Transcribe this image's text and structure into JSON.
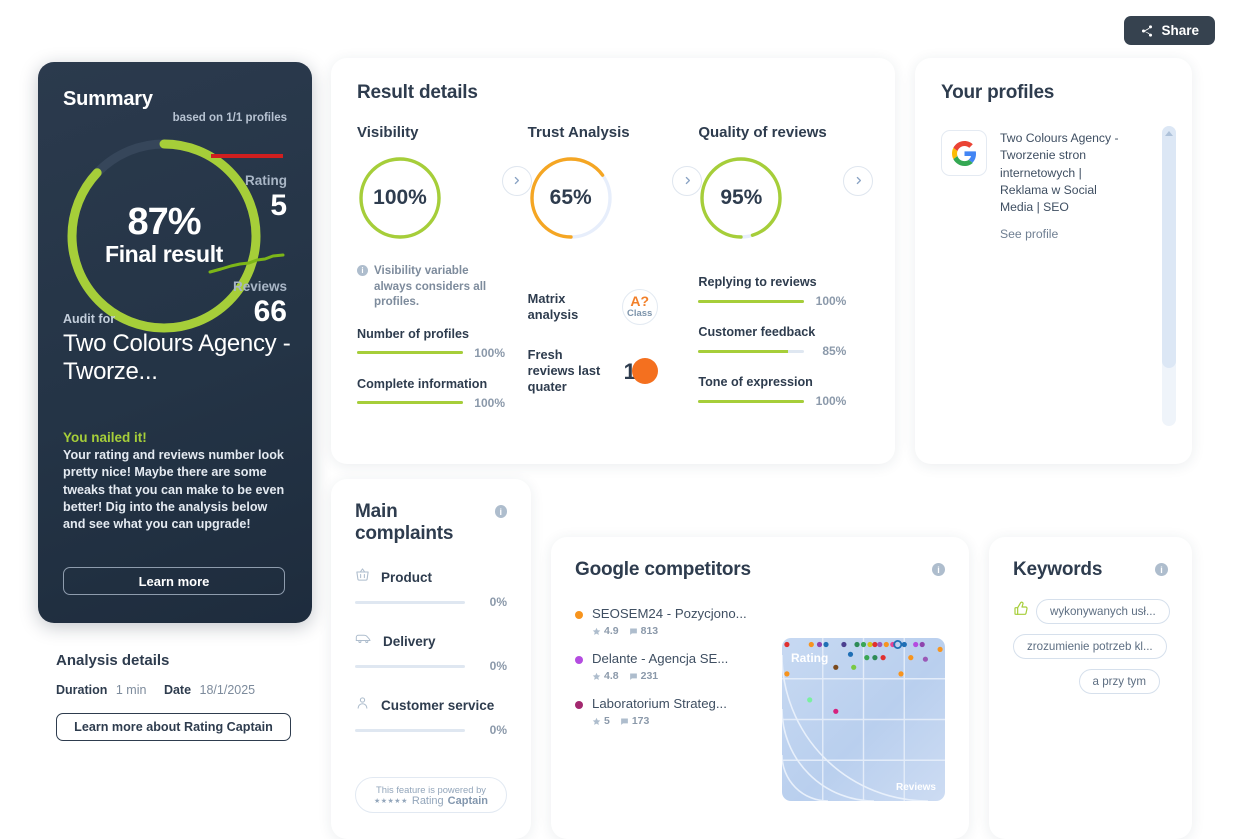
{
  "header": {
    "share_label": "Share"
  },
  "summary": {
    "title": "Summary",
    "based_on": "based on 1/1 profiles",
    "final_percent": "87%",
    "final_label": "Final result",
    "rating_label": "Rating",
    "rating_value": "5",
    "reviews_label": "Reviews",
    "reviews_value": "66",
    "audit_for_label": "Audit for",
    "audit_name": "Two Colours Agency - Tworze...",
    "nailed_title": "You nailed it!",
    "nailed_body": "Your rating and reviews number look pretty nice! Maybe there are some tweaks that you can make to be even better! Dig into the analysis below and see what you can upgrade!",
    "learn_more": "Learn more",
    "accent_green": "#a6ce39",
    "rating_trend_color": "#d01f1f",
    "reviews_trend_color": "#7cb518"
  },
  "analysis": {
    "title": "Analysis details",
    "duration_label": "Duration",
    "duration_value": "1 min",
    "date_label": "Date",
    "date_value": "18/1/2025",
    "button": "Learn more about Rating Captain"
  },
  "result": {
    "title": "Result details",
    "columns": [
      {
        "title": "Visibility",
        "percent": "100%",
        "ring_color": "#a6ce39",
        "note": "Visibility variable always considers all profiles.",
        "metrics": [
          {
            "label": "Number of profiles",
            "percent": "100%",
            "value": 100
          },
          {
            "label": "Complete information",
            "percent": "100%",
            "value": 100
          }
        ]
      },
      {
        "title": "Trust Analysis",
        "percent": "65%",
        "ring_color": "#f5a623",
        "matrix_label": "Matrix analysis",
        "matrix_class": "A?",
        "matrix_class_sub": "Class",
        "fresh_label": "Fresh reviews last quater",
        "fresh_value": "1"
      },
      {
        "title": "Quality of reviews",
        "percent": "95%",
        "ring_color": "#a6ce39",
        "metrics": [
          {
            "label": "Replying to reviews",
            "percent": "100%",
            "value": 100
          },
          {
            "label": "Customer feedback",
            "percent": "85%",
            "value": 85
          },
          {
            "label": "Tone of expression",
            "percent": "100%",
            "value": 100
          }
        ]
      }
    ]
  },
  "profiles": {
    "title": "Your profiles",
    "items": [
      {
        "name": "Two Colours Agency - Tworzenie stron internetowych | Reklama w Social Media | SEO",
        "link": "See profile"
      }
    ]
  },
  "complaints": {
    "title": "Main complaints",
    "items": [
      {
        "icon": "basket-icon",
        "label": "Product",
        "percent": "0%",
        "value": 0
      },
      {
        "icon": "van-icon",
        "label": "Delivery",
        "percent": "0%",
        "value": 0
      },
      {
        "icon": "person-icon",
        "label": "Customer service",
        "percent": "0%",
        "value": 0
      }
    ],
    "powered_line1": "This feature is powered by",
    "powered_stars": "★★★★★",
    "powered_brand_light": "Rating",
    "powered_brand_bold": "Captain"
  },
  "competitors": {
    "title": "Google competitors",
    "items": [
      {
        "name": "SEOSEM24 - Pozycjono...",
        "rating": "4.9",
        "reviews": "813",
        "color": "#f7941e"
      },
      {
        "name": "Delante - Agencja SE...",
        "rating": "4.8",
        "reviews": "231",
        "color": "#b44ce0"
      },
      {
        "name": "Laboratorium Strateg...",
        "rating": "5",
        "reviews": "173",
        "color": "#a3286f"
      }
    ]
  },
  "keywords": {
    "title": "Keywords",
    "chips": [
      "wykonywanych usł...",
      "zrozumienie potrzeb kl...",
      "a przy tym"
    ]
  },
  "chart_data": {
    "type": "scatter",
    "title": "",
    "xlabel": "Reviews",
    "ylabel": "Rating",
    "xlim": [
      0,
      100
    ],
    "ylim": [
      0,
      100
    ],
    "grid": true,
    "points": [
      {
        "x": 3,
        "y": 96,
        "color": "#e03030"
      },
      {
        "x": 18,
        "y": 96,
        "color": "#f7941e"
      },
      {
        "x": 23,
        "y": 96,
        "color": "#8e44ad"
      },
      {
        "x": 27,
        "y": 96,
        "color": "#1f6fb5"
      },
      {
        "x": 38,
        "y": 96,
        "color": "#4b3f8f"
      },
      {
        "x": 46,
        "y": 96,
        "color": "#2e8b57"
      },
      {
        "x": 50,
        "y": 96,
        "color": "#3aa655"
      },
      {
        "x": 54,
        "y": 96,
        "color": "#d4c21a"
      },
      {
        "x": 57,
        "y": 96,
        "color": "#e03030"
      },
      {
        "x": 60,
        "y": 96,
        "color": "#9b59b6"
      },
      {
        "x": 64,
        "y": 96,
        "color": "#f7941e"
      },
      {
        "x": 68,
        "y": 96,
        "color": "#e84393"
      },
      {
        "x": 75,
        "y": 96,
        "color": "#1f6fb5"
      },
      {
        "x": 82,
        "y": 96,
        "color": "#b44ce0"
      },
      {
        "x": 86,
        "y": 96,
        "color": "#8e44ad"
      },
      {
        "x": 42,
        "y": 90,
        "color": "#1f6fb5"
      },
      {
        "x": 52,
        "y": 88,
        "color": "#3aa655"
      },
      {
        "x": 57,
        "y": 88,
        "color": "#2e8b57"
      },
      {
        "x": 62,
        "y": 88,
        "color": "#e03030"
      },
      {
        "x": 79,
        "y": 88,
        "color": "#f7941e"
      },
      {
        "x": 88,
        "y": 87,
        "color": "#9b59b6"
      },
      {
        "x": 33,
        "y": 82,
        "color": "#7a4a1e"
      },
      {
        "x": 44,
        "y": 82,
        "color": "#7ac943"
      },
      {
        "x": 73,
        "y": 78,
        "color": "#f7941e"
      },
      {
        "x": 3,
        "y": 78,
        "color": "#f7941e"
      },
      {
        "x": 97,
        "y": 93,
        "color": "#f7941e"
      },
      {
        "x": 17,
        "y": 62,
        "color": "#7af0a0"
      },
      {
        "x": 33,
        "y": 55,
        "color": "#d6217e"
      }
    ],
    "highlight": {
      "x": 71,
      "y": 96,
      "color": "#1f6fb5",
      "style": "hollow-circle"
    }
  }
}
